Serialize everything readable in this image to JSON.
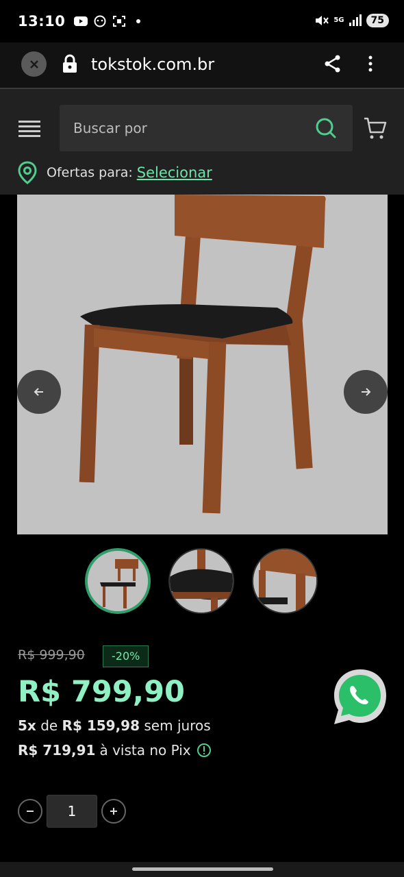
{
  "status_bar": {
    "time": "13:10",
    "network": "5G",
    "battery": "75"
  },
  "browser": {
    "url": "tokstok.com.br"
  },
  "header": {
    "search_placeholder": "Buscar por",
    "offers_label": "Ofertas para:",
    "offers_link": "Selecionar"
  },
  "product": {
    "old_price": "R$ 999,90",
    "discount": "-20%",
    "price": "R$ 799,90",
    "installments_count": "5x",
    "installments_de": "de",
    "installments_value": "R$ 159,98",
    "installments_suffix": "sem juros",
    "pix_price": "R$ 719,91",
    "pix_suffix": "à vista no Pix",
    "quantity": "1"
  },
  "colors": {
    "accent": "#8ff0c3",
    "link": "#6fe3a9",
    "header_bg": "#212121",
    "image_bg": "#c2c2c2",
    "whatsapp": "#25d366"
  },
  "icons": [
    "close-icon",
    "lock-icon",
    "share-icon",
    "more-vert-icon",
    "menu-icon",
    "search-icon",
    "cart-icon",
    "location-pin-icon",
    "arrow-left-icon",
    "arrow-right-icon",
    "whatsapp-icon",
    "info-icon",
    "minus-icon",
    "plus-icon"
  ]
}
